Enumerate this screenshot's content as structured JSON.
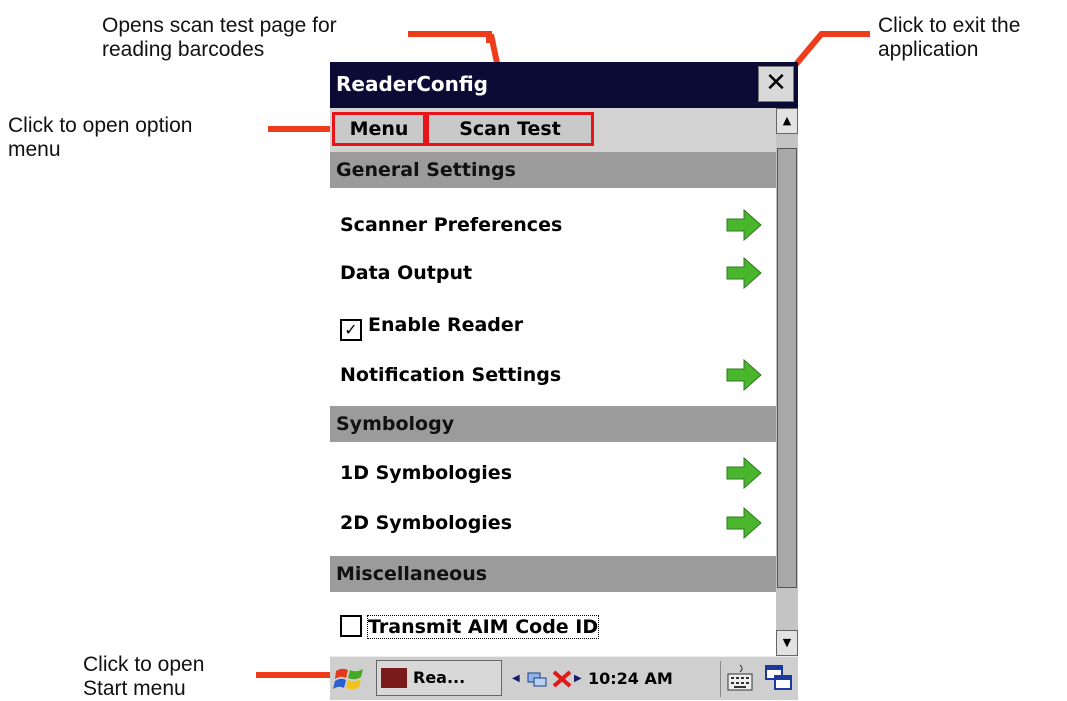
{
  "annotations": {
    "scan_test_line1": "Opens scan test page for",
    "scan_test_line2": "reading barcodes",
    "exit_line1": "Click to exit the",
    "exit_line2": "application",
    "menu_line1": "Click to open option",
    "menu_line2": "menu",
    "start_line1": "Click to open",
    "start_line2": "Start menu"
  },
  "window": {
    "title": "ReaderConfig",
    "close_glyph": "✕"
  },
  "menubar": {
    "menu_label": "Menu",
    "scan_test_label": "Scan Test"
  },
  "scrollbar": {
    "up_glyph": "▲",
    "down_glyph": "▼"
  },
  "sections": {
    "general": "General Settings",
    "symbology": "Symbology",
    "misc": "Miscellaneous"
  },
  "rows": {
    "scanner_preferences": "Scanner Preferences",
    "data_output": "Data Output",
    "enable_reader": "Enable Reader",
    "enable_reader_checked": true,
    "notification_settings": "Notification Settings",
    "symbologies_1d": "1D Symbologies",
    "symbologies_2d": "2D Symbologies",
    "transmit_aim": "Transmit AIM Code ID",
    "transmit_aim_checked": false
  },
  "taskbar": {
    "task_label": "Rea...",
    "tray_left": "◀",
    "tray_right": "▶",
    "clock": "10:24 AM"
  },
  "icons": {
    "arrow": "green-right-arrow-icon",
    "start": "windows-flag-icon",
    "keyboard": "keyboard-icon",
    "switch": "window-switch-icon"
  },
  "colors": {
    "accent": "#ef3c1a",
    "highlight": "#e8141a",
    "titlebar": "#0b0b36",
    "section": "#9b9b9b",
    "arrow": "#49b62d"
  }
}
